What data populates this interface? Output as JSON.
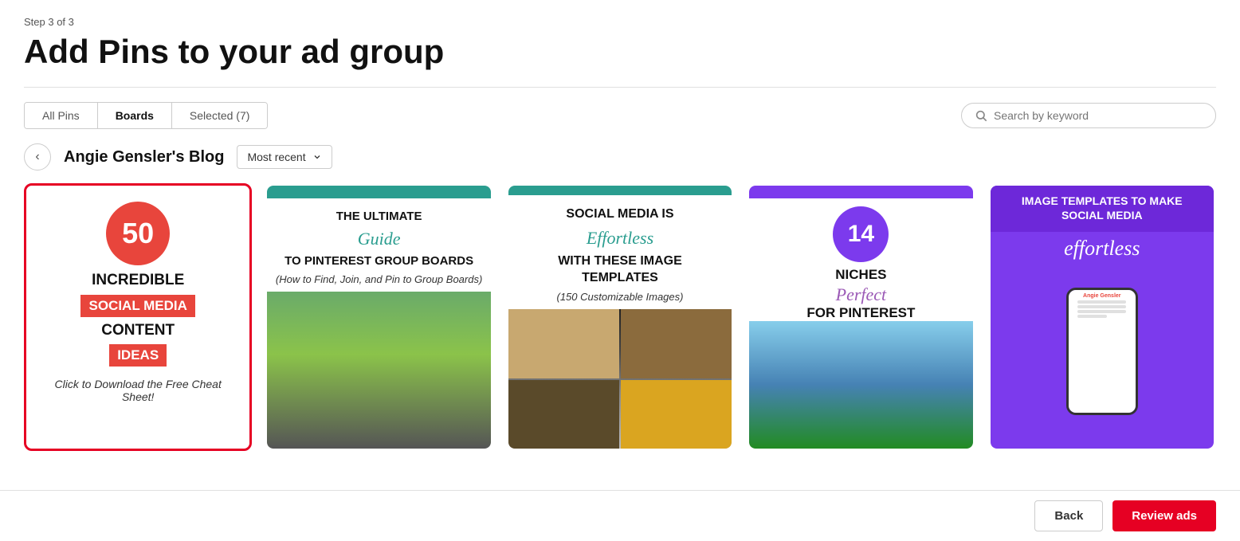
{
  "page": {
    "step_label": "Step 3 of 3",
    "title": "Add Pins to your ad group"
  },
  "tabs": {
    "all_pins": "All Pins",
    "boards": "Boards",
    "selected": "Selected (7)"
  },
  "search": {
    "placeholder": "Search by keyword"
  },
  "board": {
    "name": "Angie Gensler's Blog",
    "sort_label": "Most recent",
    "back_label": "‹"
  },
  "pins": [
    {
      "id": "pin1",
      "selected": true,
      "number": "50",
      "text1": "INCREDIBLE",
      "badge1": "SOCIAL MEDIA",
      "text2": "CONTENT",
      "badge2": "IDEAS",
      "italic": "Click to Download the Free Cheat Sheet!"
    },
    {
      "id": "pin2",
      "selected": false,
      "header_bg": "#2a9d8f",
      "text1": "THE ULTIMATE",
      "script": "Guide",
      "text2": "TO PINTEREST GROUP BOARDS",
      "subtitle": "(How to Find, Join, and Pin to Group Boards)"
    },
    {
      "id": "pin3",
      "selected": false,
      "header_bg": "#2a9d8f",
      "text1": "SOCIAL MEDIA IS",
      "script": "Effortless",
      "text2": "WITH THESE IMAGE TEMPLATES",
      "subtitle": "(150 Customizable Images)"
    },
    {
      "id": "pin4",
      "selected": false,
      "header_bg": "#7c3aed",
      "number": "14",
      "text1": "NICHES",
      "script": "Perfect",
      "text2": "FOR PINTEREST"
    },
    {
      "id": "pin5",
      "selected": false,
      "bg": "#7c3aed",
      "text1": "IMAGE TEMPLATES TO MAKE SOCIAL MEDIA",
      "script": "effortless",
      "phone_label": "Angie Gensler"
    }
  ],
  "buttons": {
    "back": "Back",
    "review": "Review ads"
  }
}
